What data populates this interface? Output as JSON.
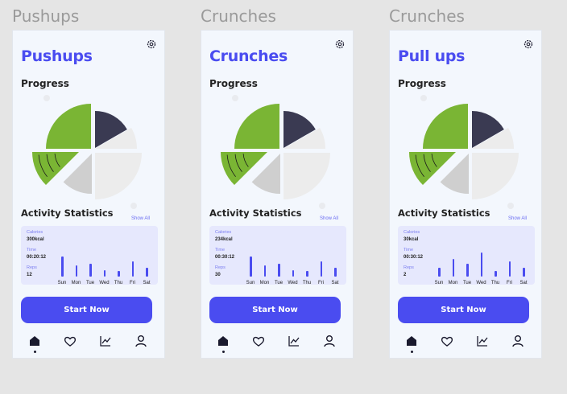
{
  "frames": [
    {
      "frame_label": "Pushups",
      "title": "Pushups",
      "progress_label": "Progress",
      "stats_title": "Activity Statistics",
      "show_all": "Show All",
      "calories_label": "Calories",
      "calories_value": "300kcal",
      "time_label": "Time",
      "time_value": "00:20:12",
      "reps_label": "Reps",
      "reps_value": "12",
      "days": [
        "Sun",
        "Mon",
        "Tue",
        "Wed",
        "Thu",
        "Fri",
        "Sat"
      ],
      "bar_levels": [
        0.6,
        0.33,
        0.37,
        0.2,
        0.17,
        0.46,
        0.27
      ],
      "start_button": "Start Now"
    },
    {
      "frame_label": "Crunches",
      "title": "Crunches",
      "progress_label": "Progress",
      "stats_title": "Activity Statistics",
      "show_all": "Show All",
      "calories_label": "Calories",
      "calories_value": "234kcal",
      "time_label": "Time",
      "time_value": "00:30:12",
      "reps_label": "Reps",
      "reps_value": "30",
      "days": [
        "Sun",
        "Mon",
        "Tue",
        "Wed",
        "Thu",
        "Fri",
        "Sat"
      ],
      "bar_levels": [
        0.6,
        0.33,
        0.37,
        0.2,
        0.17,
        0.46,
        0.27
      ],
      "start_button": "Start Now"
    },
    {
      "frame_label": "Crunches",
      "title": "Pull ups",
      "progress_label": "Progress",
      "stats_title": "Activity Statistics",
      "show_all": "Show All",
      "calories_label": "Calories",
      "calories_value": "30kcal",
      "time_label": "Time",
      "time_value": "00:30:12",
      "reps_label": "Reps",
      "reps_value": "2",
      "days": [
        "Sun",
        "Mon",
        "Tue",
        "Wed",
        "Thu",
        "Fri",
        "Sat"
      ],
      "bar_levels": [
        0.27,
        0.52,
        0.37,
        0.72,
        0.17,
        0.46,
        0.27
      ],
      "start_button": "Start Now"
    }
  ],
  "colors": {
    "accent": "#4a4cf0",
    "pie_green": "#7ab534",
    "pie_dark": "#3a3a52",
    "pie_light": "#ececec",
    "pie_mid": "#cfcfcf",
    "stats_card": "#e6e8fd",
    "phone_bg": "#f3f7fd"
  },
  "nav_icons": [
    "home-icon",
    "heart-icon",
    "chart-icon",
    "user-icon"
  ]
}
